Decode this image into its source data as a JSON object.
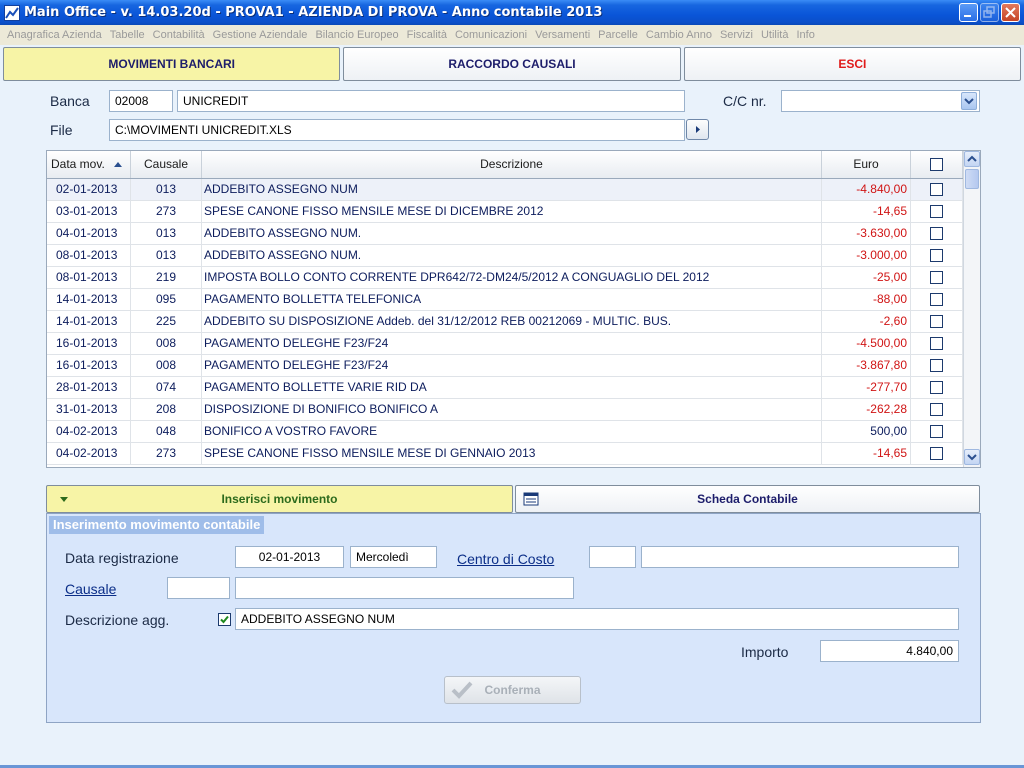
{
  "window": {
    "title": "Main Office - v. 14.03.20d - PROVA1 - AZIENDA DI PROVA - Anno contabile 2013"
  },
  "menu": [
    "Anagrafica Azienda",
    "Tabelle",
    "Contabilità",
    "Gestione Aziendale",
    "Bilancio Europeo",
    "Fiscalità",
    "Comunicazioni",
    "Versamenti",
    "Parcelle",
    "Cambio Anno",
    "Servizi",
    "Utilità",
    "Info"
  ],
  "top_tabs": {
    "movimenti": "MOVIMENTI BANCARI",
    "raccordo": "RACCORDO CAUSALI",
    "esci": "ESCI"
  },
  "filters": {
    "banca_label": "Banca",
    "banca_code": "02008",
    "banca_name": "UNICREDIT",
    "cc_label": "C/C nr.",
    "cc_value": "",
    "file_label": "File",
    "file_path": "C:\\MOVIMENTI UNICREDIT.XLS"
  },
  "grid": {
    "headers": {
      "data": "Data mov.",
      "causale": "Causale",
      "descrizione": "Descrizione",
      "euro": "Euro"
    },
    "rows": [
      {
        "data": "02-01-2013",
        "causale": "013",
        "descrizione": "ADDEBITO ASSEGNO NUM",
        "euro": "-4.840,00"
      },
      {
        "data": "03-01-2013",
        "causale": "273",
        "descrizione": "SPESE CANONE FISSO MENSILE MESE DI DICEMBRE 2012",
        "euro": "-14,65"
      },
      {
        "data": "04-01-2013",
        "causale": "013",
        "descrizione": "ADDEBITO ASSEGNO NUM.",
        "euro": "-3.630,00"
      },
      {
        "data": "08-01-2013",
        "causale": "013",
        "descrizione": "ADDEBITO ASSEGNO NUM.",
        "euro": "-3.000,00"
      },
      {
        "data": "08-01-2013",
        "causale": "219",
        "descrizione": "IMPOSTA BOLLO CONTO CORRENTE DPR642/72-DM24/5/2012 A CONGUAGLIO DEL 2012",
        "euro": "-25,00"
      },
      {
        "data": "14-01-2013",
        "causale": "095",
        "descrizione": "PAGAMENTO BOLLETTA TELEFONICA",
        "euro": "-88,00"
      },
      {
        "data": "14-01-2013",
        "causale": "225",
        "descrizione": "ADDEBITO SU DISPOSIZIONE Addeb. del 31/12/2012 REB 00212069 - MULTIC. BUS.",
        "euro": "-2,60"
      },
      {
        "data": "16-01-2013",
        "causale": "008",
        "descrizione": "PAGAMENTO DELEGHE F23/F24",
        "euro": "-4.500,00"
      },
      {
        "data": "16-01-2013",
        "causale": "008",
        "descrizione": "PAGAMENTO DELEGHE F23/F24",
        "euro": "-3.867,80"
      },
      {
        "data": "28-01-2013",
        "causale": "074",
        "descrizione": "PAGAMENTO BOLLETTE VARIE RID DA",
        "euro": "-277,70"
      },
      {
        "data": "31-01-2013",
        "causale": "208",
        "descrizione": "DISPOSIZIONE DI BONIFICO BONIFICO A",
        "euro": "-262,28"
      },
      {
        "data": "04-02-2013",
        "causale": "048",
        "descrizione": "BONIFICO A VOSTRO FAVORE",
        "euro": "500,00"
      },
      {
        "data": "04-02-2013",
        "causale": "273",
        "descrizione": "SPESE CANONE FISSO MENSILE MESE DI GENNAIO 2013",
        "euro": "-14,65"
      }
    ]
  },
  "lower_tabs": {
    "inserisci": "Inserisci movimento",
    "scheda": "Scheda Contabile"
  },
  "form": {
    "panel_title": "Inserimento movimento contabile",
    "data_reg_label": "Data registrazione",
    "data_reg_value": "02-01-2013",
    "giorno_value": "Mercoledì",
    "centro_costo_label": "Centro di Costo",
    "centro_costo_code": "",
    "centro_costo_desc": "",
    "causale_label": "Causale",
    "causale_code": "",
    "causale_desc": "",
    "descr_agg_label": "Descrizione agg.",
    "descr_agg_value": "ADDEBITO ASSEGNO NUM",
    "importo_label": "Importo",
    "importo_value": "4.840,00",
    "confirm_label": "Conferma"
  }
}
